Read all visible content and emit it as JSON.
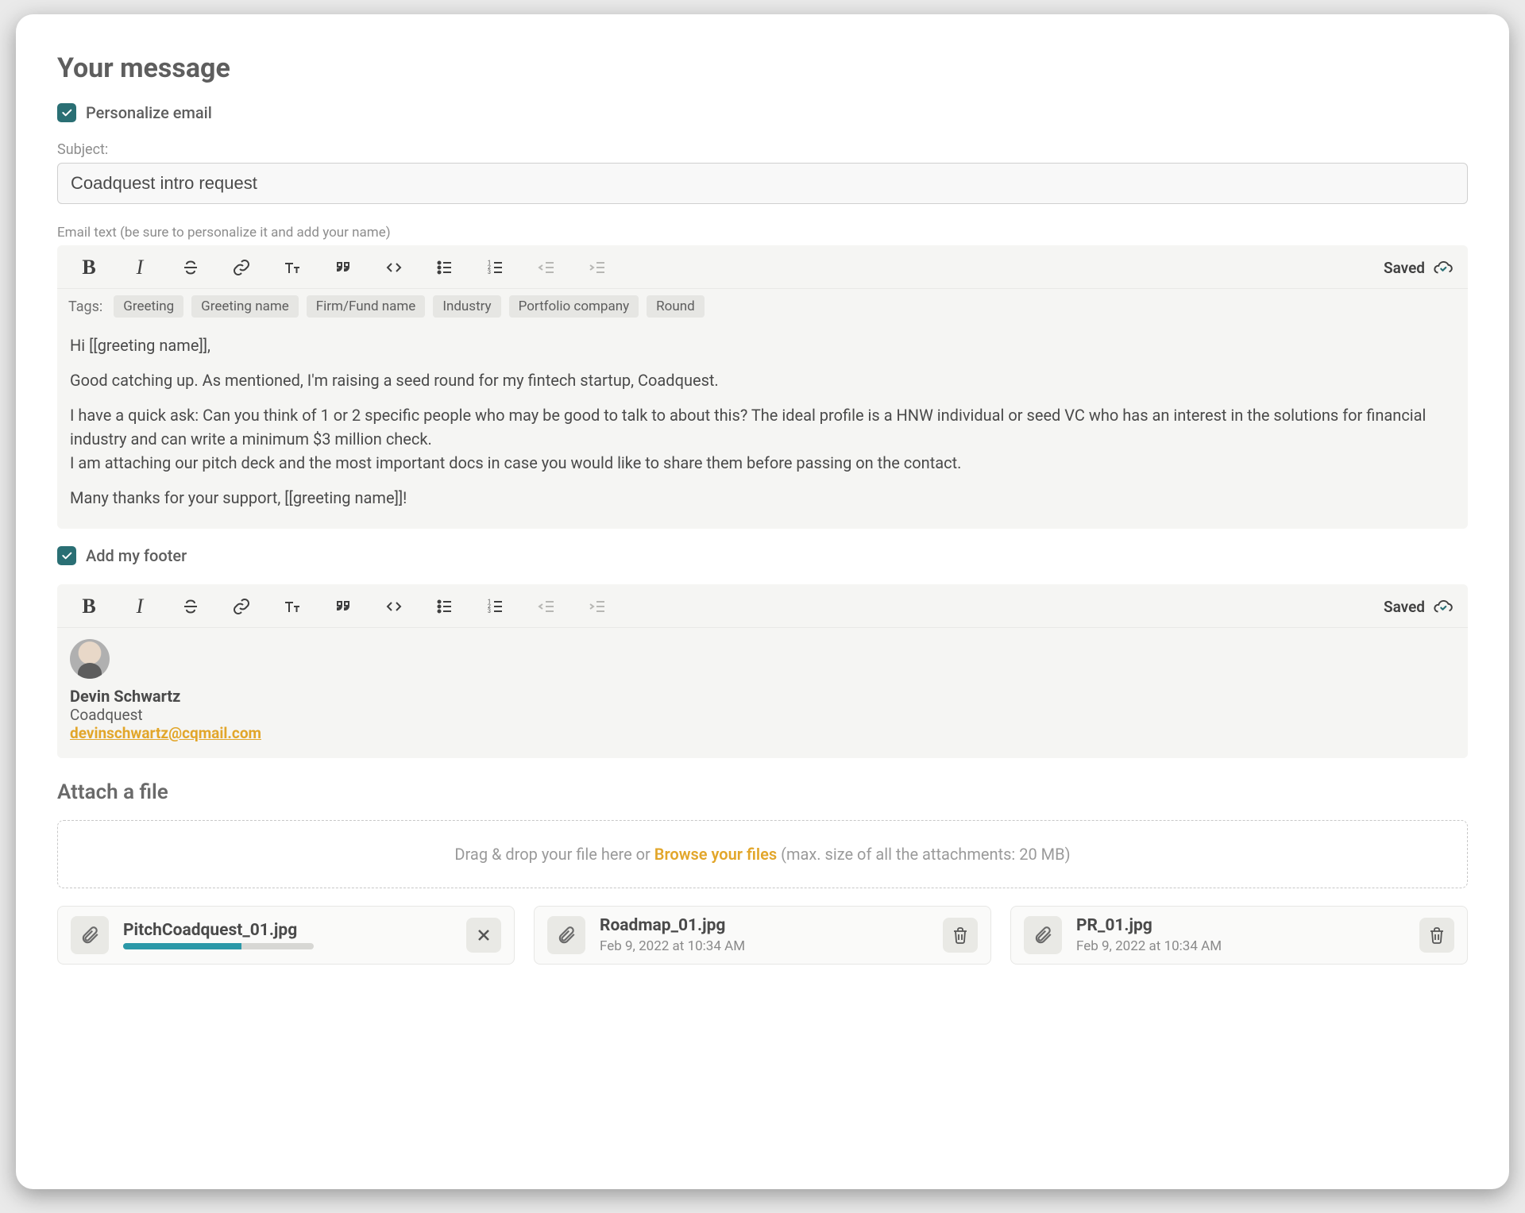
{
  "title": "Your message",
  "personalize": {
    "label": "Personalize email",
    "checked": true
  },
  "subject": {
    "label": "Subject:",
    "value": "Coadquest intro request"
  },
  "emailHint": "Email text (be sure to personalize it and add your name)",
  "savedLabel": "Saved",
  "tagsLabel": "Tags:",
  "tags": [
    "Greeting",
    "Greeting name",
    "Firm/Fund name",
    "Industry",
    "Portfolio company",
    "Round"
  ],
  "body": {
    "p1": "Hi [[greeting name]],",
    "p2": "Good catching up. As mentioned, I'm raising a seed round for my fintech startup, Coadquest.",
    "p3a": "I have a quick ask: Can you think of 1 or 2 specific people who may be good to talk to about this? The ideal profile is a HNW individual or seed VC who has an interest in the solutions for financial industry and can write a minimum $3 million check.",
    "p3b": "I am attaching our pitch deck and the most important docs in case you would like to share them before passing on the contact.",
    "p4": "Many thanks for your support,  [[greeting name]]!"
  },
  "footerToggle": {
    "label": "Add my footer",
    "checked": true
  },
  "signature": {
    "name": "Devin Schwartz",
    "company": "Coadquest",
    "email": "devinschwartz@cqmail.com"
  },
  "attach": {
    "title": "Attach a file",
    "dragText": "Drag & drop your file here or ",
    "browse": "Browse your files",
    "limit": " (max. size of all the attachments: 20 MB)"
  },
  "files": [
    {
      "name": "PitchCoadquest_01.jpg",
      "uploading": true,
      "progress": 62
    },
    {
      "name": "Roadmap_01.jpg",
      "sub": "Feb 9, 2022 at 10:34 AM",
      "uploading": false
    },
    {
      "name": "PR_01.jpg",
      "sub": "Feb 9, 2022 at 10:34 AM",
      "uploading": false
    }
  ]
}
